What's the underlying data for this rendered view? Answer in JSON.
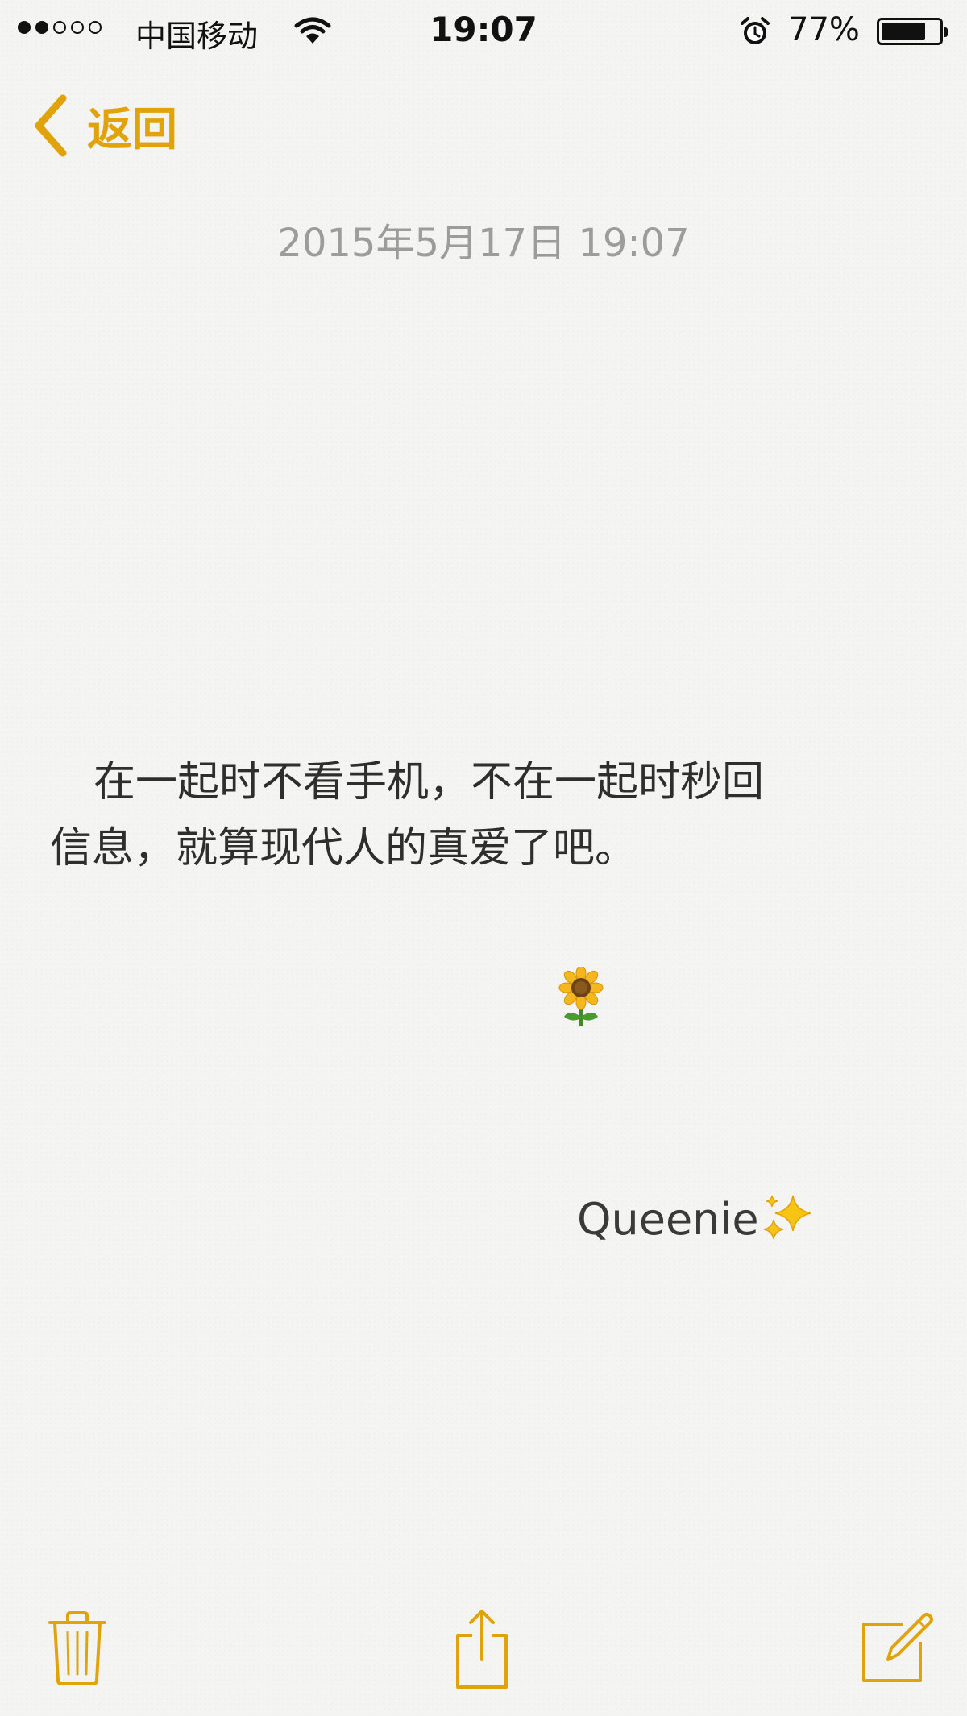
{
  "status_bar": {
    "signal_bars_filled": 2,
    "signal_bars_total": 5,
    "carrier": "中国移动",
    "time": "19:07",
    "battery_percent": "77%",
    "battery_level": 0.77
  },
  "nav": {
    "back_label": "返回"
  },
  "note": {
    "date": "2015年5月17日 19:07",
    "body_line_1": "在一起时不看手机，不在一起时秒回",
    "body_line_2": "信息，就算现代人的真爱了吧。",
    "signature": "Queenie"
  },
  "colors": {
    "accent": "#e0a30b",
    "background": "#f4f4f2",
    "date_text": "#9c9c9c",
    "body_text": "#2e2e2e"
  },
  "icons": {
    "back": "chevron-left-icon",
    "wifi": "wifi-icon",
    "alarm": "alarm-icon",
    "sunflower": "sunflower-emoji",
    "sparkles": "sparkles-emoji",
    "trash": "trash-icon",
    "share": "share-icon",
    "compose": "compose-icon"
  }
}
